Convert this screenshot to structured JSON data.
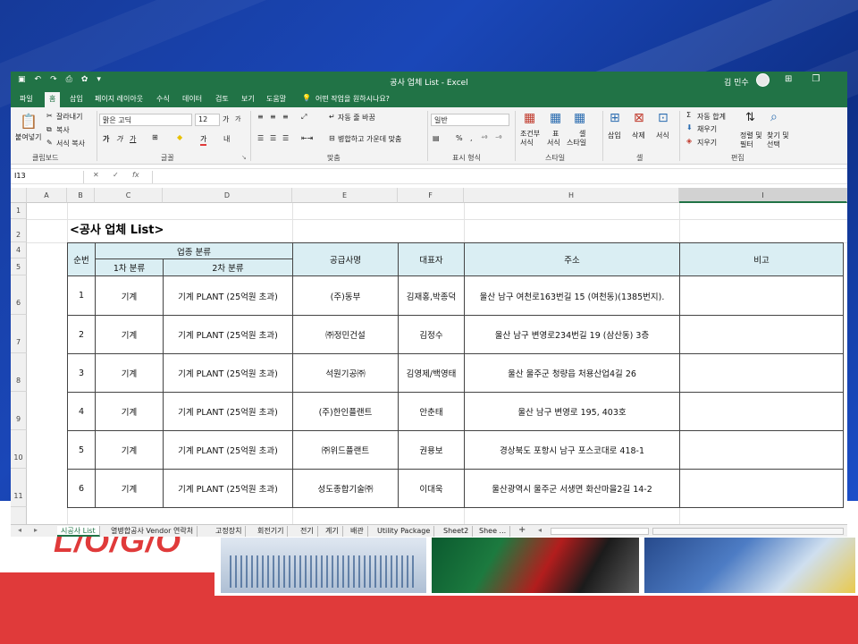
{
  "slide": {
    "logo_text": "L/O/G/O",
    "accent_red": "#e03a3a",
    "background_blue": "#1a47b8"
  },
  "excel": {
    "window_title": "공사 업체 List  -  Excel",
    "user_name": "김 민수",
    "brand_color": "#217346",
    "ribbon_tabs": [
      "파일",
      "홈",
      "삽입",
      "페이지 레이아웃",
      "수식",
      "데이터",
      "검토",
      "보기",
      "도움말"
    ],
    "tell_me": "어떤 작업을 원하시나요?",
    "clipboard": {
      "paste": "붙여넣기",
      "cut": "잘라내기",
      "copy": "복사",
      "format_painter": "서식 복사",
      "group": "클립보드"
    },
    "font": {
      "name": "맑은 고딕",
      "size": "12",
      "group": "글꼴",
      "bold": "가",
      "italic": "가",
      "underline": "가",
      "grow": "가",
      "shrink": "가",
      "phonetic": "내",
      "color_letter": "가"
    },
    "alignment": {
      "wrap": "자동 줄 바꿈",
      "merge": "병합하고 가운데 맞춤",
      "group": "맞춤"
    },
    "number": {
      "format": "일반",
      "percent": "%",
      "comma": ",",
      "group": "표시 형식"
    },
    "styles": {
      "conditional": "조건부",
      "conditional2": "서식",
      "table": "표",
      "table2": "서식",
      "cell": "셀",
      "cell2": "스타일",
      "group": "스타일"
    },
    "cells": {
      "insert": "삽입",
      "delete": "삭제",
      "format": "서식",
      "group": "셀"
    },
    "editing": {
      "autosum": "자동 합계",
      "fill": "채우기",
      "clear": "지우기",
      "sort": "정렬 및",
      "sort2": "필터",
      "find": "찾기 및",
      "find2": "선택",
      "group": "편집"
    },
    "name_box": "I13",
    "fx": "fx",
    "cancel_mark": "✕",
    "enter_mark": "✓",
    "columns": [
      "A",
      "B",
      "C",
      "D",
      "E",
      "F",
      "H",
      "I"
    ],
    "rows": [
      "1",
      "2",
      "4",
      "5",
      "6",
      "7",
      "8",
      "9",
      "10",
      "11"
    ],
    "sheet_title": "<공사 업체 List>",
    "headers": {
      "no": "순번",
      "category": "업종 분류",
      "cat1": "1차 분류",
      "cat2": "2차 분류",
      "supplier": "공급사명",
      "ceo": "대표자",
      "address": "주소",
      "note": "비고"
    },
    "table_rows": [
      {
        "no": "1",
        "cat1": "기계",
        "cat2": "기계 PLANT (25억원 초과)",
        "supplier": "(주)동부",
        "ceo": "김재홍,박종덕",
        "address": "울산 남구 여천로163번길 15 (여천동)(1385번지).",
        "note": ""
      },
      {
        "no": "2",
        "cat1": "기계",
        "cat2": "기계 PLANT (25억원 초과)",
        "supplier": "㈜정민건설",
        "ceo": "김정수",
        "address": "울산 남구 변영로234번길 19 (삼산동) 3층",
        "note": ""
      },
      {
        "no": "3",
        "cat1": "기계",
        "cat2": "기계 PLANT (25억원 초과)",
        "supplier": "석원기공㈜",
        "ceo": "김영제/백영태",
        "address": "울산 울주군 청량읍 처용산업4길 26",
        "note": ""
      },
      {
        "no": "4",
        "cat1": "기계",
        "cat2": "기계 PLANT (25억원 초과)",
        "supplier": "(주)한인플랜트",
        "ceo": "안춘태",
        "address": "울산 남구 변영로 195, 403호",
        "note": ""
      },
      {
        "no": "5",
        "cat1": "기계",
        "cat2": "기계 PLANT (25억원 초과)",
        "supplier": "㈜위드플랜트",
        "ceo": "권용보",
        "address": "경상북도 포항시 남구 포스코대로 418-1",
        "note": ""
      },
      {
        "no": "6",
        "cat1": "기계",
        "cat2": "기계 PLANT (25억원 초과)",
        "supplier": "성도종합기술㈜",
        "ceo": "이대욱",
        "address": "울산광역시 울주군 서생면 화산마을2길 14-2",
        "note": ""
      }
    ],
    "sheet_tabs": [
      "시공사 List",
      "열병합공사 Vendor 연락처",
      "고정장치",
      "회전기기",
      "전기",
      "계기",
      "배관",
      "Utility Package",
      "Sheet2",
      "Shee ..."
    ],
    "add_sheet": "+"
  }
}
